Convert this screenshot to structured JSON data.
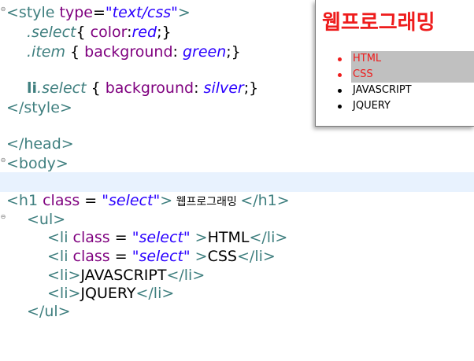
{
  "editor": {
    "lines": [
      {
        "t1": "<style ",
        "t2": "type",
        "t3": "=",
        "t4": "\"text/css\"",
        "t5": ">"
      },
      {
        "sel": ".select",
        "rest1": "{ ",
        "prop": "color",
        "colon": ":",
        "val": "red",
        "end": ";}"
      },
      {
        "sel": ".item",
        "rest1": " { ",
        "prop": "background",
        "colon": ": ",
        "val": "green",
        "end": ";}"
      },
      {
        "kw": "li",
        "sel": ".select",
        "rest1": " { ",
        "prop": "background",
        "colon": ": ",
        "val": "silver",
        "end": ";}"
      },
      {
        "close": "</style>"
      },
      {
        "close": "</head>"
      },
      {
        "close": "<body>"
      },
      {
        "o": "<h1 ",
        "a": "class",
        "eq": " = ",
        "v": "\"select\"",
        "gt": ">",
        "txt": " 웹프로그래밍 ",
        "c": "</h1>"
      },
      {
        "o": "<ul>"
      },
      {
        "o": "<li ",
        "a": "class",
        "eq": " = ",
        "v": "\"select\"",
        "gt": " >",
        "txt": "HTML",
        "c": "</li>"
      },
      {
        "o": "<li ",
        "a": "class",
        "eq": " = ",
        "v": "\"select\"",
        "gt": " >",
        "txt": "CSS",
        "c": "</li>"
      },
      {
        "o": "<li>",
        "txt": "JAVASCRIPT",
        "c": "</li>"
      },
      {
        "o": "<li>",
        "txt": "JQUERY",
        "c": "</li>"
      },
      {
        "o": "</ul>"
      }
    ]
  },
  "preview": {
    "title": "웹프로그래밍",
    "items": [
      "HTML",
      "CSS",
      "JAVASCRIPT",
      "JQUERY"
    ],
    "colors": {
      "heading": "#ee1c1c",
      "selected_bg": "#c0c0c0"
    }
  }
}
